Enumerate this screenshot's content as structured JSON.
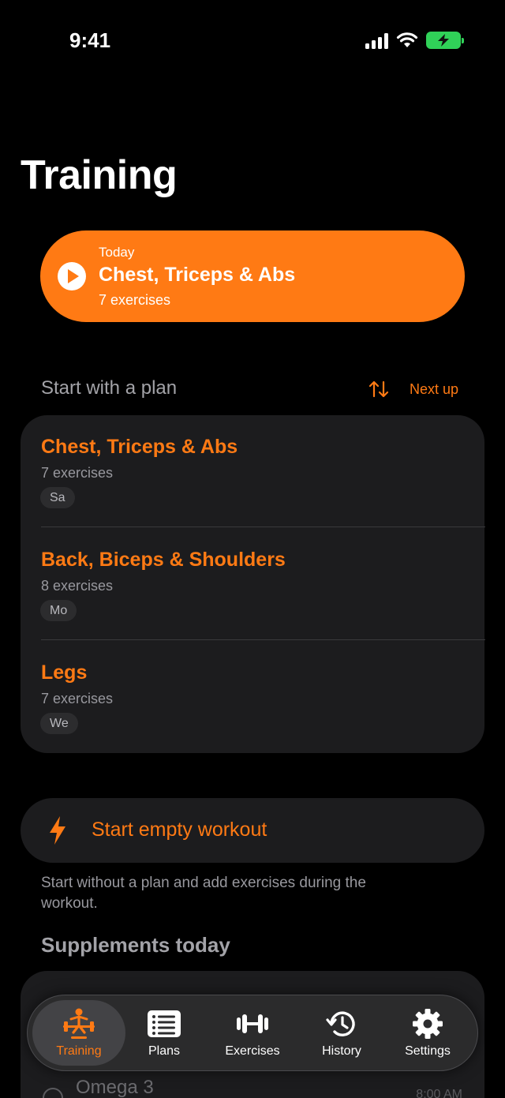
{
  "status_bar": {
    "time": "9:41"
  },
  "page": {
    "title": "Training"
  },
  "today": {
    "label": "Today",
    "title": "Chest, Triceps & Abs",
    "subtitle": "7 exercises"
  },
  "plans_section": {
    "heading": "Start with a plan",
    "sort_label": "Next up",
    "plans": [
      {
        "title": "Chest, Triceps & Abs",
        "count": "7 exercises",
        "day": "Sa"
      },
      {
        "title": "Back, Biceps & Shoulders",
        "count": "8 exercises",
        "day": "Mo"
      },
      {
        "title": "Legs",
        "count": "7 exercises",
        "day": "We"
      }
    ]
  },
  "empty_workout": {
    "label": "Start empty workout",
    "description": "Start without a plan and add exercises during the workout."
  },
  "supplements": {
    "heading": "Supplements today",
    "items": [
      {
        "name": "Omega 3",
        "time": "8:00 AM"
      }
    ]
  },
  "tab_bar": {
    "tabs": [
      {
        "label": "Training",
        "active": true
      },
      {
        "label": "Plans",
        "active": false
      },
      {
        "label": "Exercises",
        "active": false
      },
      {
        "label": "History",
        "active": false
      },
      {
        "label": "Settings",
        "active": false
      }
    ]
  },
  "colors": {
    "accent": "#ff7a14",
    "background": "#000000",
    "card": "#1c1c1e",
    "battery": "#30d158"
  }
}
